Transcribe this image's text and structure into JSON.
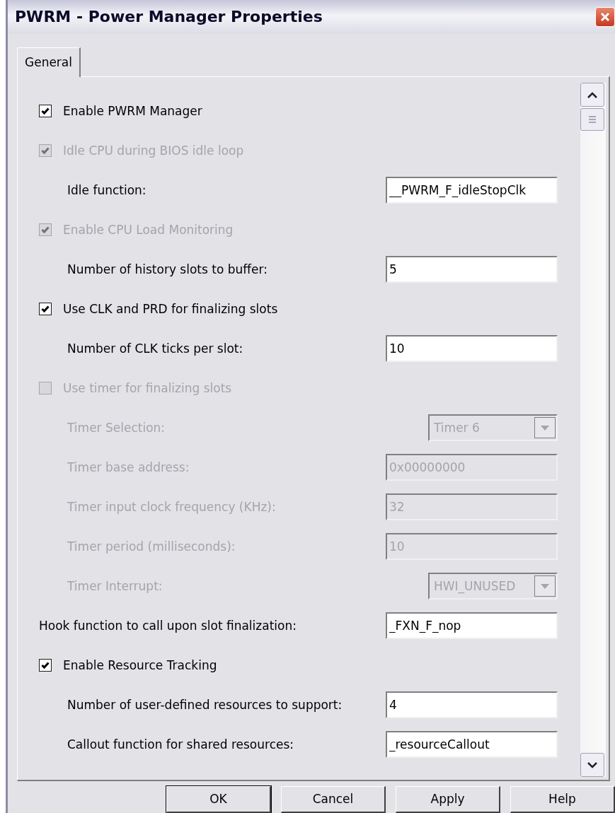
{
  "window": {
    "title": "PWRM - Power Manager Properties"
  },
  "tabs": [
    {
      "label": "General",
      "selected": true
    }
  ],
  "settings": [
    {
      "kind": "checkbox",
      "label": "Enable PWRM Manager",
      "checked": true,
      "disabled": false
    },
    {
      "kind": "checkbox",
      "label": "Idle CPU during BIOS idle loop",
      "checked": true,
      "disabled": true,
      "children": [
        {
          "kind": "field",
          "label": "Idle function:",
          "value": "__PWRM_F_idleStopClk",
          "disabled": false
        }
      ]
    },
    {
      "kind": "checkbox",
      "label": "Enable CPU Load Monitoring",
      "checked": true,
      "disabled": true,
      "children": [
        {
          "kind": "field",
          "label": "Number of history slots to buffer:",
          "value": "5",
          "disabled": false
        }
      ]
    },
    {
      "kind": "checkbox",
      "label": "Use CLK and PRD for finalizing slots",
      "checked": true,
      "disabled": false,
      "children": [
        {
          "kind": "field",
          "label": "Number of CLK ticks per slot:",
          "value": "10",
          "disabled": false
        }
      ]
    },
    {
      "kind": "checkbox",
      "label": "Use timer for finalizing slots",
      "checked": false,
      "disabled": true,
      "children": [
        {
          "kind": "select",
          "label": "Timer Selection:",
          "value": "Timer 6",
          "disabled": true
        },
        {
          "kind": "field",
          "label": "Timer base address:",
          "value": "0x00000000",
          "disabled": true
        },
        {
          "kind": "field",
          "label": "Timer input clock frequency (KHz):",
          "value": "32",
          "disabled": true
        },
        {
          "kind": "field",
          "label": "Timer period (milliseconds):",
          "value": "10",
          "disabled": true
        },
        {
          "kind": "select",
          "label": "Timer Interrupt:",
          "value": "HWI_UNUSED",
          "disabled": true
        }
      ]
    },
    {
      "kind": "field",
      "label": "Hook function to call upon slot finalization:",
      "value": "_FXN_F_nop",
      "disabled": false
    },
    {
      "kind": "checkbox",
      "label": "Enable Resource Tracking",
      "checked": true,
      "disabled": false,
      "children": [
        {
          "kind": "field",
          "label": "Number of user-defined resources to support:",
          "value": "4",
          "disabled": false
        },
        {
          "kind": "field",
          "label": "Callout function for shared resources:",
          "value": "_resourceCallout",
          "disabled": false
        }
      ]
    }
  ],
  "buttons": [
    {
      "label": "OK",
      "default": true
    },
    {
      "label": "Cancel",
      "default": false
    },
    {
      "label": "Apply",
      "default": false
    },
    {
      "label": "Help",
      "default": false
    }
  ]
}
